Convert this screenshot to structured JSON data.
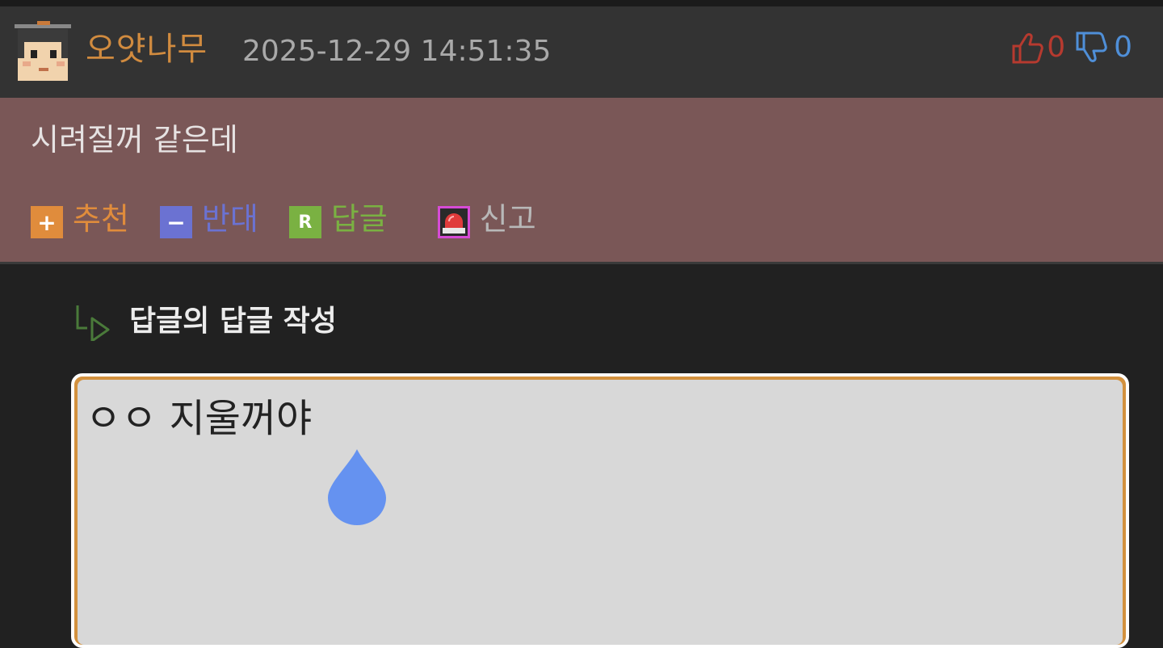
{
  "post": {
    "username": "오얏나무",
    "timestamp": "2025-12-29 14:51:35",
    "upvotes": "0",
    "downvotes": "0"
  },
  "comment": {
    "text": "시려질꺼 같은데"
  },
  "actions": {
    "recommend": {
      "badge": "+",
      "label": "추천"
    },
    "oppose": {
      "badge": "−",
      "label": "반대"
    },
    "reply": {
      "badge": "R",
      "label": "답글"
    },
    "report": {
      "label": "신고"
    }
  },
  "reply_form": {
    "title": "답글의 답글 작성",
    "input_value": "ㅇㅇ 지울꺼야"
  },
  "colors": {
    "accent_orange": "#d18b3f",
    "upvote_red": "#b63a2f",
    "downvote_blue": "#4f8fd8",
    "comment_bg": "#7a5757"
  },
  "icons": [
    "avatar",
    "thumbs-up-icon",
    "thumbs-down-icon",
    "plus-icon",
    "minus-icon",
    "reply-icon",
    "siren-icon",
    "reply-arrow-icon",
    "water-drop-icon"
  ]
}
